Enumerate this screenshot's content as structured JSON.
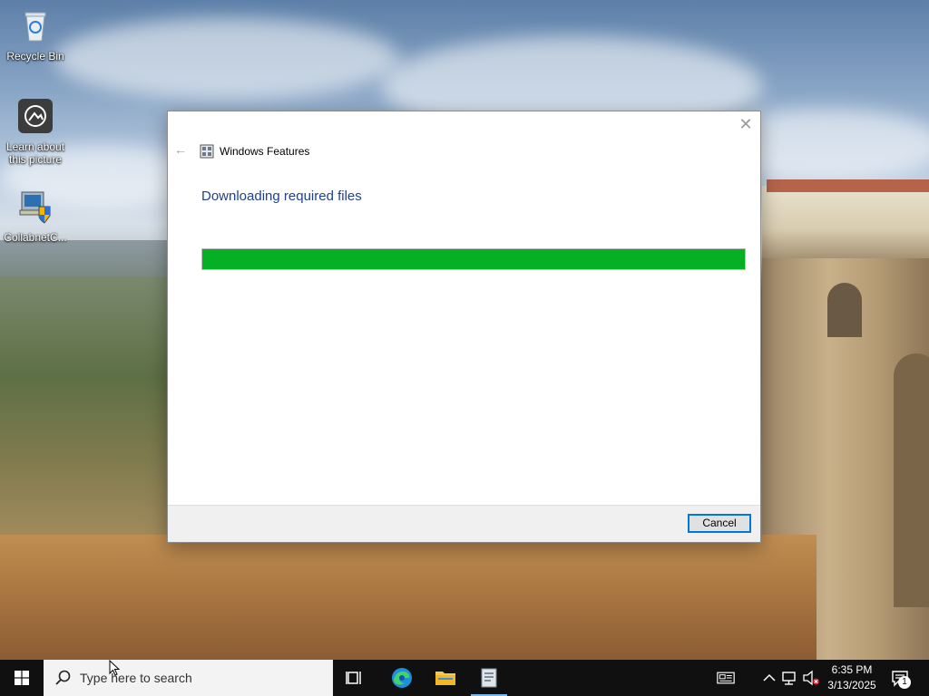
{
  "desktop": {
    "icons": [
      {
        "label": "Recycle Bin",
        "icon": "recycle-bin-icon"
      },
      {
        "label": "Learn about this picture",
        "icon": "camera-icon"
      },
      {
        "label": "CollabnetC...",
        "icon": "setup-shield-icon"
      }
    ]
  },
  "dialog": {
    "title": "Windows Features",
    "heading": "Downloading required files",
    "progress_percent": 100,
    "progress_color": "#06b025",
    "cancel_label": "Cancel",
    "close_glyph": "✕",
    "back_glyph": "←"
  },
  "taskbar": {
    "search_placeholder": "Type here to search",
    "pinned": [
      {
        "name": "task-view",
        "icon": "task-view-icon"
      },
      {
        "name": "edge",
        "icon": "edge-icon"
      },
      {
        "name": "file-explorer",
        "icon": "folder-icon"
      },
      {
        "name": "windows-features",
        "icon": "windows-features-icon",
        "active": true
      }
    ],
    "tray": {
      "time": "6:35 PM",
      "date": "3/13/2025",
      "notification_count": "1"
    }
  },
  "colors": {
    "accent": "#0078d7",
    "heading": "#1f3f8f",
    "taskbar": "#101010"
  }
}
